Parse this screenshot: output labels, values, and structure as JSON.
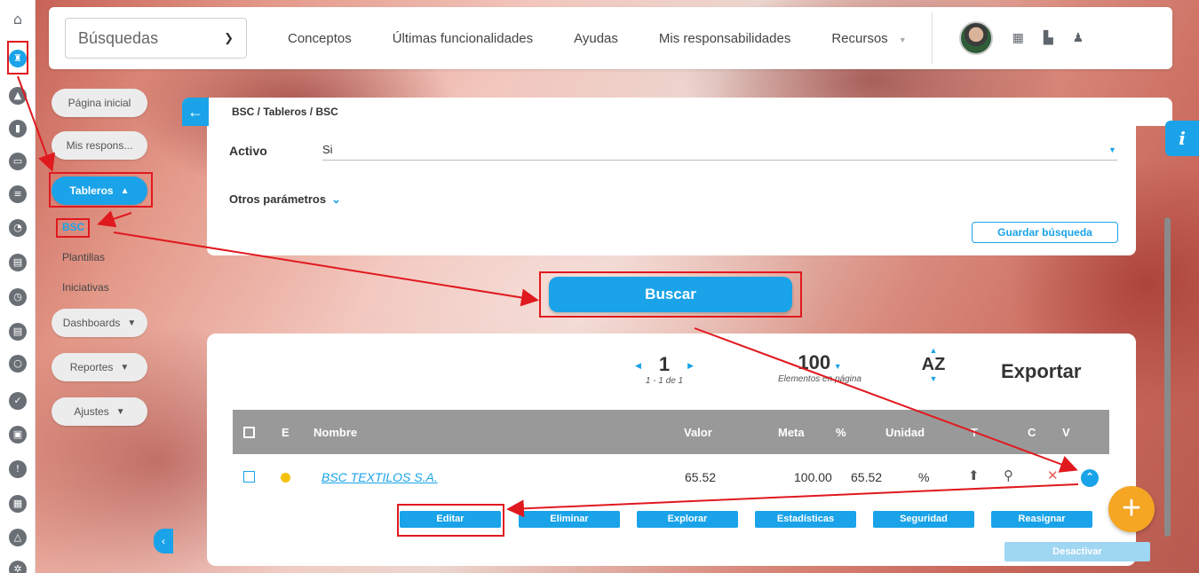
{
  "topbar": {
    "search_select": "Búsquedas",
    "nav": [
      "Conceptos",
      "Últimas funcionalidades",
      "Ayudas",
      "Mis responsabilidades",
      "Recursos"
    ]
  },
  "menu": {
    "pagina_inicial": "Página inicial",
    "mis_respons": "Mis respons...",
    "tableros": "Tableros",
    "sub": [
      "BSC",
      "Plantillas",
      "Iniciativas"
    ],
    "dashboards": "Dashboards",
    "reportes": "Reportes",
    "ajustes": "Ajustes"
  },
  "breadcrumb": "BSC / Tableros / BSC",
  "filters": {
    "activo_label": "Activo",
    "activo_value": "Si",
    "otros_parametros": "Otros parámetros",
    "guardar_busqueda": "Guardar búsqueda"
  },
  "buscar": "Buscar",
  "results": {
    "page": "1",
    "page_range": "1 - 1 de 1",
    "per_page": "100",
    "per_page_label": "Elementos en página",
    "sort": "AZ",
    "export": "Exportar",
    "columns": {
      "e": "E",
      "nombre": "Nombre",
      "valor": "Valor",
      "meta": "Meta",
      "pct": "%",
      "unidad": "Unidad",
      "t": "T",
      "c": "C",
      "v": "V"
    },
    "rows": [
      {
        "nombre": "BSC TEXTILOS S.A.",
        "valor": "65.52",
        "meta": "100.00",
        "pct": "65.52",
        "unidad": "%"
      }
    ],
    "actions": [
      "Editar",
      "Eliminar",
      "Explorar",
      "Estadísticas",
      "Seguridad",
      "Reasignar",
      "Desactivar"
    ]
  },
  "colors": {
    "accent": "#1aa3e8",
    "fab": "#f5a623",
    "highlight": "#e0191f"
  }
}
